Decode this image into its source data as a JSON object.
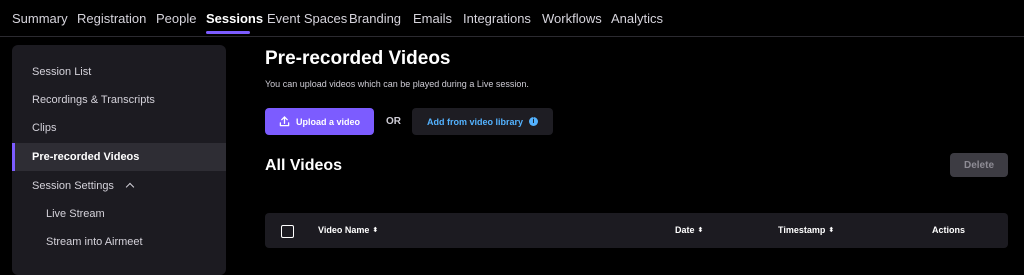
{
  "top_nav": {
    "tabs": [
      {
        "label": "Summary"
      },
      {
        "label": "Registration"
      },
      {
        "label": "People"
      },
      {
        "label": "Sessions",
        "active": true
      },
      {
        "label": "Event Spaces"
      },
      {
        "label": "Branding"
      },
      {
        "label": "Emails"
      },
      {
        "label": "Integrations"
      },
      {
        "label": "Workflows"
      },
      {
        "label": "Analytics"
      }
    ]
  },
  "sidebar": {
    "items": [
      {
        "label": "Session List"
      },
      {
        "label": "Recordings & Transcripts"
      },
      {
        "label": "Clips"
      },
      {
        "label": "Pre-recorded Videos",
        "active": true
      },
      {
        "label": "Session Settings",
        "expanded": true
      },
      {
        "label": "Live Stream",
        "sub": true
      },
      {
        "label": "Stream into Airmeet",
        "sub": true
      }
    ]
  },
  "main": {
    "title": "Pre-recorded Videos",
    "description": "You can upload videos which can be played during a Live session.",
    "upload_label": "Upload a video",
    "or_label": "OR",
    "library_label": "Add from video library",
    "section_title": "All Videos",
    "delete_label": "Delete",
    "columns": [
      "Video Name",
      "Date",
      "Timestamp",
      "Actions"
    ]
  },
  "colors": {
    "accent": "#7c5cff",
    "link": "#53b2ff",
    "background": "#000000",
    "panel": "#1c1b21"
  }
}
